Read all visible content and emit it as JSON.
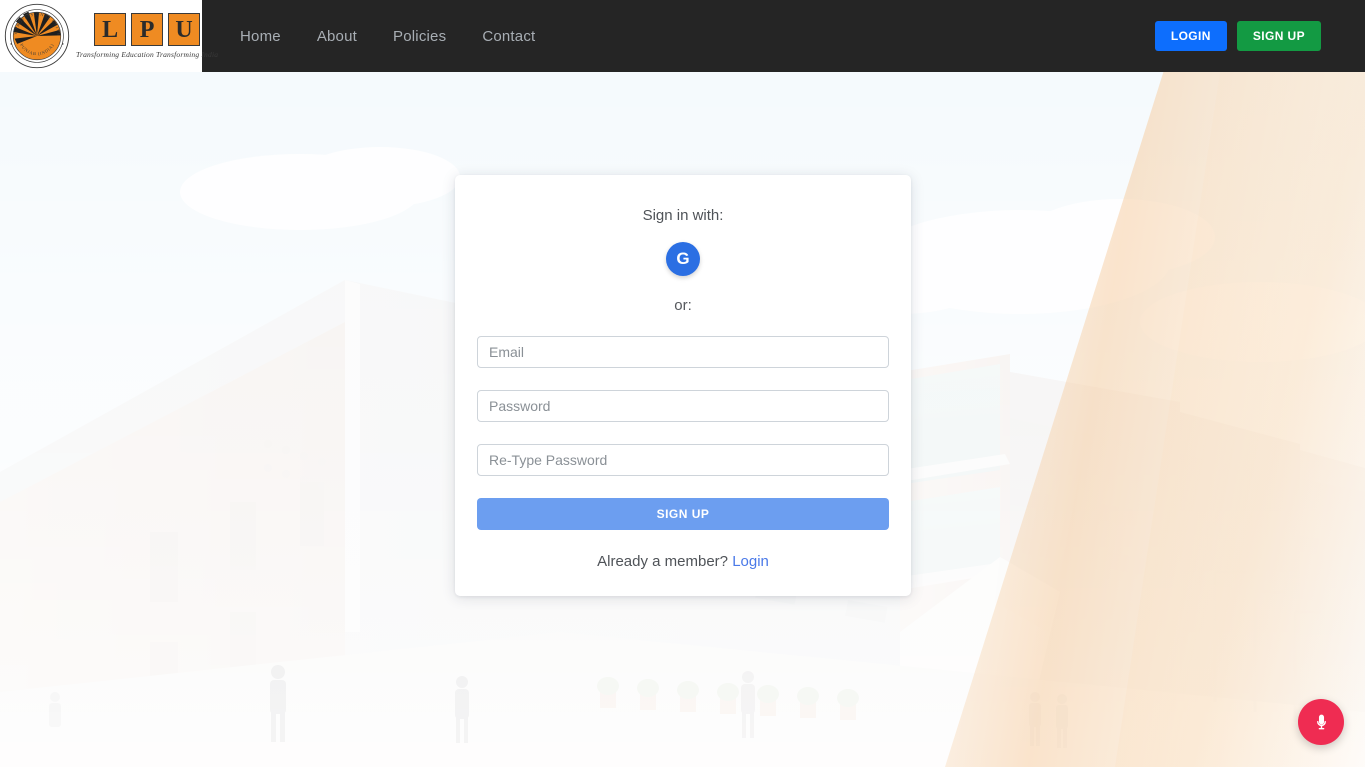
{
  "navbar": {
    "brand": {
      "seal_top_text": "LOVELY PROFESSIONAL UNIVERSITY",
      "seal_bottom_text": "PUNJAB (INDIA)",
      "letters": [
        "L",
        "P",
        "U"
      ],
      "tagline": "Transforming Education Transforming India"
    },
    "links": [
      {
        "label": "Home"
      },
      {
        "label": "About"
      },
      {
        "label": "Policies"
      },
      {
        "label": "Contact"
      }
    ],
    "actions": {
      "login_label": "LOGIN",
      "signup_label": "SIGN UP",
      "login_color": "#0d6efd",
      "signup_color": "#139a43"
    },
    "background_color": "#252525",
    "link_color": "#a8aeb4"
  },
  "auth_card": {
    "signin_with_label": "Sign in with:",
    "google_button": {
      "glyph": "G",
      "icon_name": "google-icon",
      "color": "#2b6fe3"
    },
    "or_label": "or:",
    "fields": [
      {
        "name": "email",
        "placeholder": "Email",
        "value": "",
        "type": "email"
      },
      {
        "name": "password",
        "placeholder": "Password",
        "value": "",
        "type": "password"
      },
      {
        "name": "retype-password",
        "placeholder": "Re-Type Password",
        "value": "",
        "type": "password"
      }
    ],
    "submit_label": "SIGN UP",
    "submit_color": "#6c9ef0",
    "footer": {
      "prompt": "Already a member?",
      "link_label": "Login",
      "link_color": "#4a79e8"
    }
  },
  "mic_fab": {
    "icon_name": "microphone-icon",
    "color": "#ef2c52"
  }
}
